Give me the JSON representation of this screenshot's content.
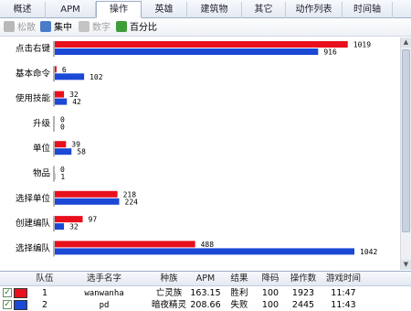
{
  "tabs": [
    {
      "label": "概述",
      "active": false
    },
    {
      "label": "APM",
      "active": false
    },
    {
      "label": "操作",
      "active": true
    },
    {
      "label": "英雄",
      "active": false
    },
    {
      "label": "建筑物",
      "active": false
    },
    {
      "label": "其它",
      "active": false
    },
    {
      "label": "动作列表",
      "active": false
    },
    {
      "label": "时间轴",
      "active": false
    }
  ],
  "toolbar": {
    "loose": {
      "label": "松散",
      "enabled": false
    },
    "focus": {
      "label": "集中",
      "enabled": true
    },
    "number": {
      "label": "数字",
      "enabled": false
    },
    "percent": {
      "label": "百分比",
      "enabled": true
    }
  },
  "colors": {
    "player1": "#e8101c",
    "player2": "#1c48d6"
  },
  "chart_data": {
    "type": "bar",
    "orientation": "horizontal",
    "categories": [
      "点击右键",
      "基本命令",
      "使用技能",
      "升级",
      "单位",
      "物品",
      "选择单位",
      "创建编队",
      "选择编队"
    ],
    "series": [
      {
        "name": "wanwanha",
        "values": [
          1019,
          6,
          32,
          0,
          39,
          0,
          218,
          97,
          488
        ]
      },
      {
        "name": "pd",
        "values": [
          916,
          102,
          42,
          0,
          58,
          1,
          224,
          32,
          1042
        ]
      }
    ],
    "xmax": 1042
  },
  "players": {
    "headers": [
      "队伍",
      "选手名字",
      "种族",
      "APM",
      "结果",
      "降码",
      "操作数",
      "游戏时间"
    ],
    "rows": [
      {
        "checked": true,
        "color": "#e8101c",
        "team": "1",
        "name": "wanwanha",
        "race": "亡灵族",
        "apm": "163.15",
        "result": "胜利",
        "handicap": "100",
        "actions": "1923",
        "time": "11:47"
      },
      {
        "checked": true,
        "color": "#1c48d6",
        "team": "2",
        "name": "pd",
        "race": "暗夜精灵",
        "apm": "208.66",
        "result": "失败",
        "handicap": "100",
        "actions": "2445",
        "time": "11:43"
      }
    ]
  }
}
